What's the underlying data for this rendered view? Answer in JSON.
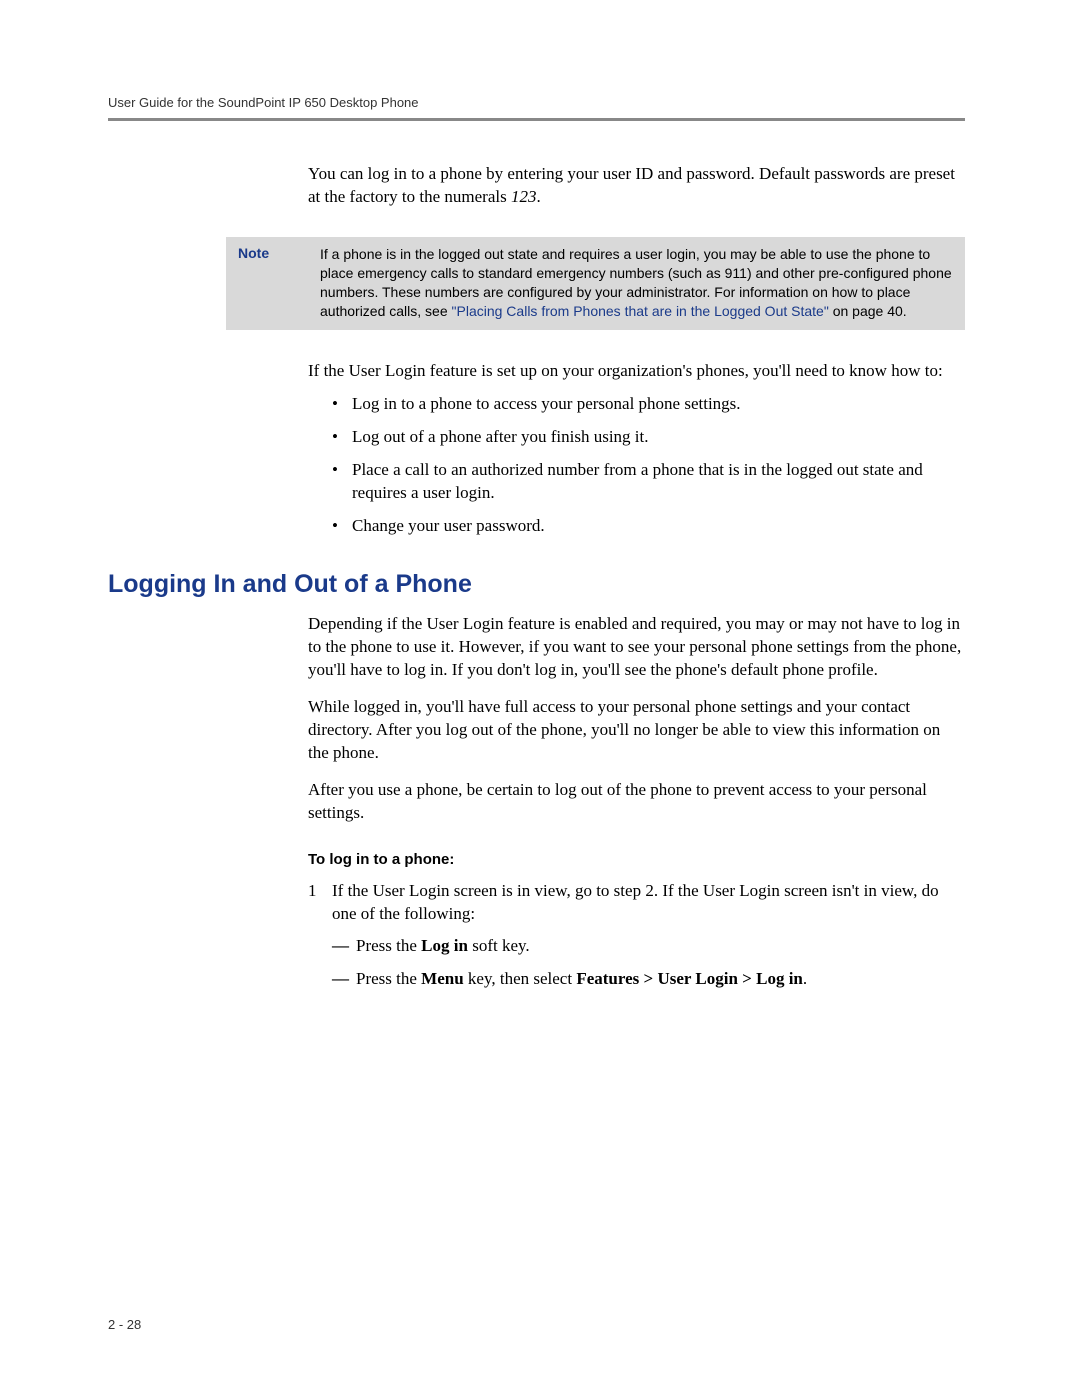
{
  "header": {
    "title": "User Guide for the SoundPoint IP 650 Desktop Phone"
  },
  "intro": {
    "text_before": "You can log in to a phone by entering your user ID and password. Default passwords are preset at the factory to the numerals ",
    "default_password": "123",
    "text_after": "."
  },
  "note": {
    "label": "Note",
    "text_before_link": "If a phone is in the logged out state and requires a user login, you may be able to use the phone to place emergency calls to standard emergency numbers (such as 911) and other pre-configured phone numbers. These numbers are configured by your administrator. For information on how to place authorized calls, see ",
    "link_text": "\"Placing Calls from Phones that are in the Logged Out State\"",
    "text_after_link": " on page 40."
  },
  "para1": "If the User Login feature is set up on your organization's phones, you'll need to know how to:",
  "bullets": [
    "Log in to a phone to access your personal phone settings.",
    "Log out of a phone after you finish using it.",
    "Place a call to an authorized number from a phone that is in the logged out state and requires a user login.",
    "Change your user password."
  ],
  "section": {
    "heading": "Logging In and Out of a Phone",
    "para1": "Depending if the User Login feature is enabled and required, you may or may not have to log in to the phone to use it. However, if you want to see your personal phone settings from the phone, you'll have to log in. If you don't log in, you'll see the phone's default phone profile.",
    "para2": "While logged in, you'll have full access to your personal phone settings and your contact directory. After you log out of the phone, you'll no longer be able to view this information on the phone.",
    "para3": "After you use a phone, be certain to log out of the phone to prevent access to your personal settings."
  },
  "procedure": {
    "heading": "To log in to a phone:",
    "step1_num": "1",
    "step1_text": "If the User Login screen is in view, go to step 2. If the User Login screen isn't in view, do one of the following:",
    "dash1_before": "Press the ",
    "dash1_bold": "Log in",
    "dash1_after": " soft key.",
    "dash2_before": "Press the ",
    "dash2_bold1": "Menu",
    "dash2_mid": " key, then select ",
    "dash2_bold2": "Features > User Login > Log in",
    "dash2_after": "."
  },
  "footer": {
    "page_number": "2 - 28"
  }
}
